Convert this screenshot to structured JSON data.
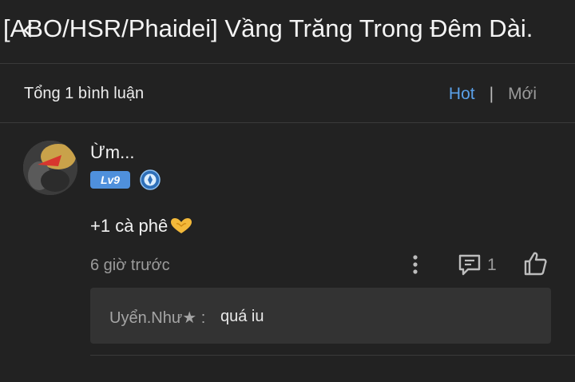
{
  "header": {
    "title": "[ABO/HSR/Phaidei] Vầng Trăng Trong Đêm Dài.",
    "back_icon": "chevron-left-icon"
  },
  "comments_bar": {
    "total_label": "Tổng 1 bình luận",
    "sort_hot": "Hot",
    "sort_separator": "|",
    "sort_new": "Mới",
    "active_sort_color": "#5aa0e8"
  },
  "comment": {
    "username": "Ừm...",
    "level": "Lv9",
    "level_color": "#4f90dc",
    "medal_icon": "blue-medal-icon",
    "text": "+1 cà phê",
    "emoji_icon": "heart-hands-emoji-icon",
    "time": "6 giờ trước",
    "reply_count": "1",
    "reply": {
      "author": "Uyển.Như★ :",
      "content": "quá iu"
    }
  }
}
